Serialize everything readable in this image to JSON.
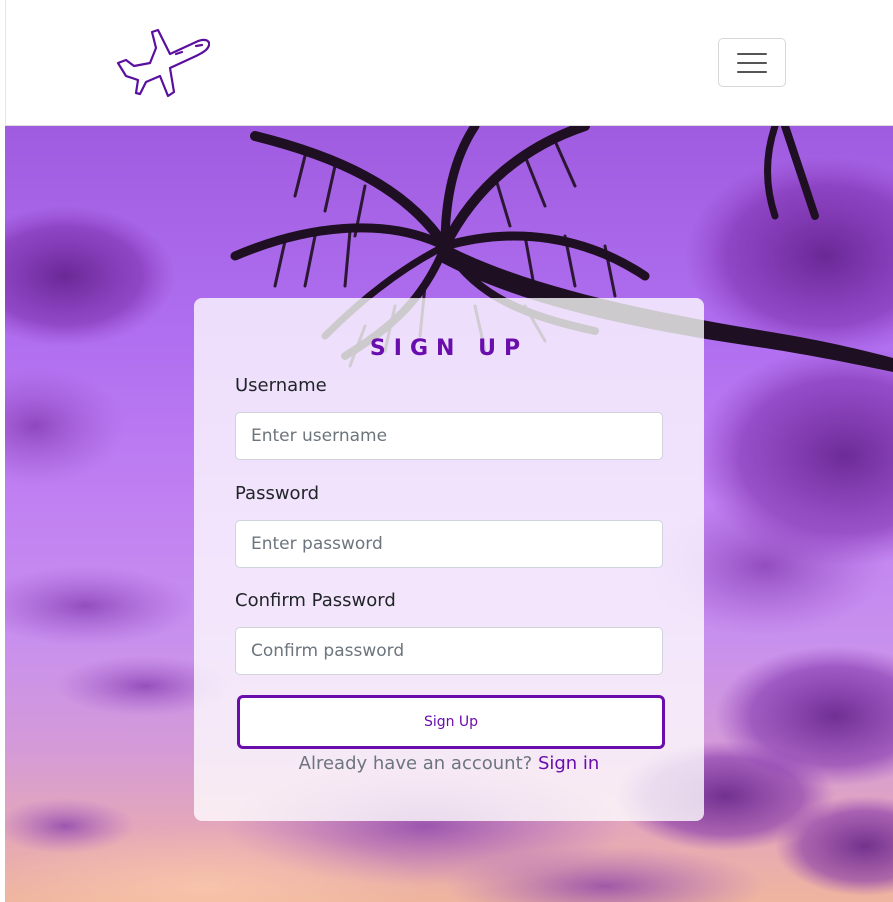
{
  "navbar": {
    "logo_icon": "airplane-icon",
    "toggler_icon": "hamburger-menu-icon"
  },
  "form": {
    "title": "SIGN UP",
    "username": {
      "label": "Username",
      "placeholder": "Enter username",
      "value": ""
    },
    "password": {
      "label": "Password",
      "placeholder": "Enter password",
      "value": ""
    },
    "confirm_password": {
      "label": "Confirm Password",
      "placeholder": "Confirm password",
      "value": ""
    },
    "submit_label": "Sign Up",
    "signin_prompt": "Already have an account?",
    "signin_link": "Sign in"
  },
  "colors": {
    "accent": "#6a0dad",
    "background_top": "#a05ce0",
    "background_bottom": "#efb59e"
  }
}
